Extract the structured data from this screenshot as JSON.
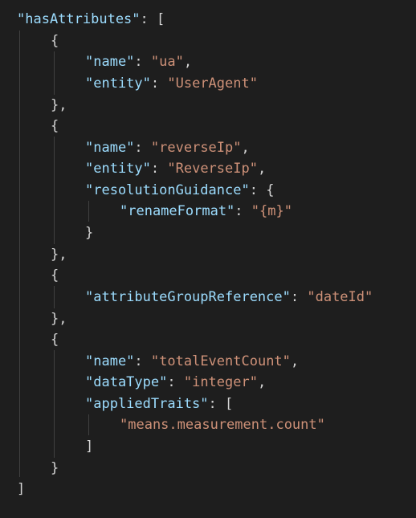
{
  "code": {
    "root_key": "\"hasAttributes\"",
    "colon": ": ",
    "comma": ",",
    "open_bracket": "[",
    "close_bracket": "]",
    "open_brace": "{",
    "close_brace": "}",
    "close_brace_comma": "},",
    "items": [
      {
        "name_key": "\"name\"",
        "name_value": "\"ua\"",
        "entity_key": "\"entity\"",
        "entity_value": "\"UserAgent\""
      },
      {
        "name_key": "\"name\"",
        "name_value": "\"reverseIp\"",
        "entity_key": "\"entity\"",
        "entity_value": "\"ReverseIp\"",
        "guidance_key": "\"resolutionGuidance\"",
        "rename_key": "\"renameFormat\"",
        "rename_value": "\"{m}\""
      },
      {
        "ref_key": "\"attributeGroupReference\"",
        "ref_value": "\"dateId\""
      },
      {
        "name_key": "\"name\"",
        "name_value": "\"totalEventCount\"",
        "datatype_key": "\"dataType\"",
        "datatype_value": "\"integer\"",
        "traits_key": "\"appliedTraits\"",
        "trait_value": "\"means.measurement.count\""
      }
    ]
  },
  "colors": {
    "background": "#1e1e1e",
    "key": "#9cdcfe",
    "string": "#ce9178",
    "punctuation": "#d4d4d4",
    "indent_guide": "#404040"
  }
}
